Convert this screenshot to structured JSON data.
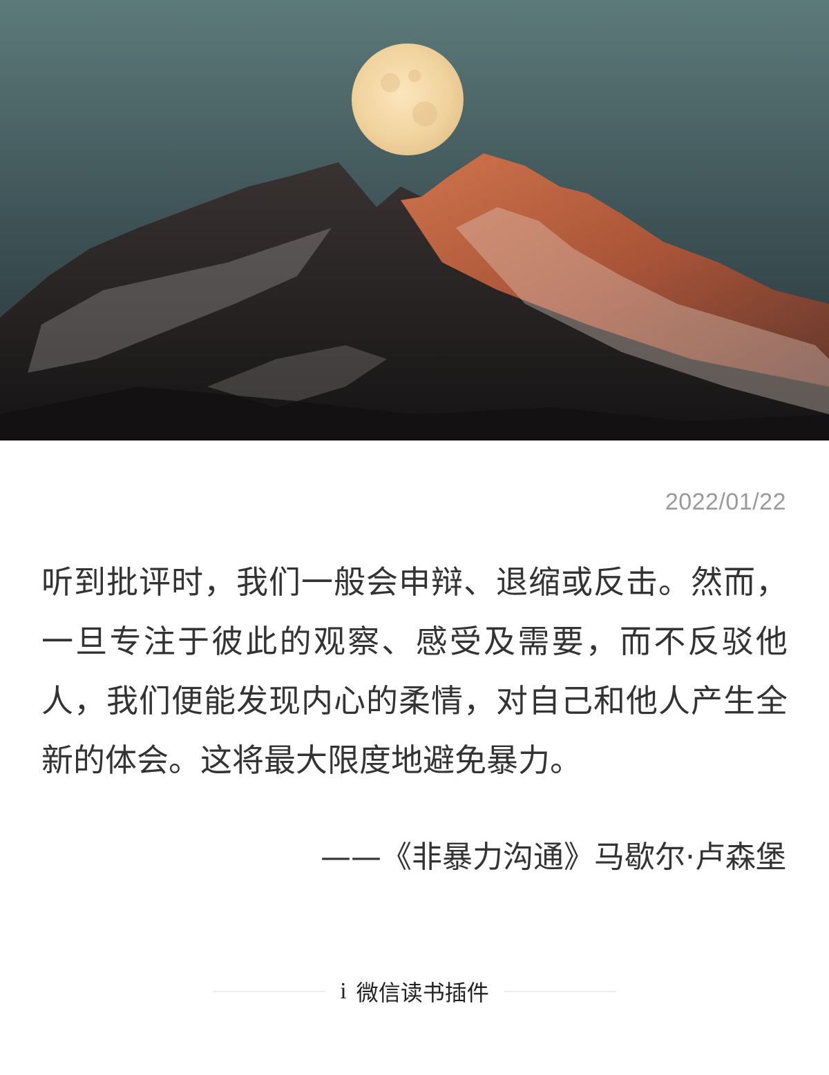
{
  "date": "2022/01/22",
  "quote": "听到批评时，我们一般会申辩、退缩或反击。然而，一旦专注于彼此的观察、感受及需要，而不反驳他人，我们便能发现内心的柔情，对自己和他人产生全新的体会。这将最大限度地避免暴力。",
  "attribution": "——《非暴力沟通》马歇尔·卢森堡",
  "footer": {
    "brand_icon": "i",
    "brand_label": "微信读书插件"
  },
  "hero": {
    "description_icon": "moon-over-mountain-photo",
    "colors": {
      "sky_top": "#4f6b6e",
      "sky_bottom": "#2b3a40",
      "moon": "#f3d9a8",
      "alpenglow": "#c9643d"
    }
  }
}
